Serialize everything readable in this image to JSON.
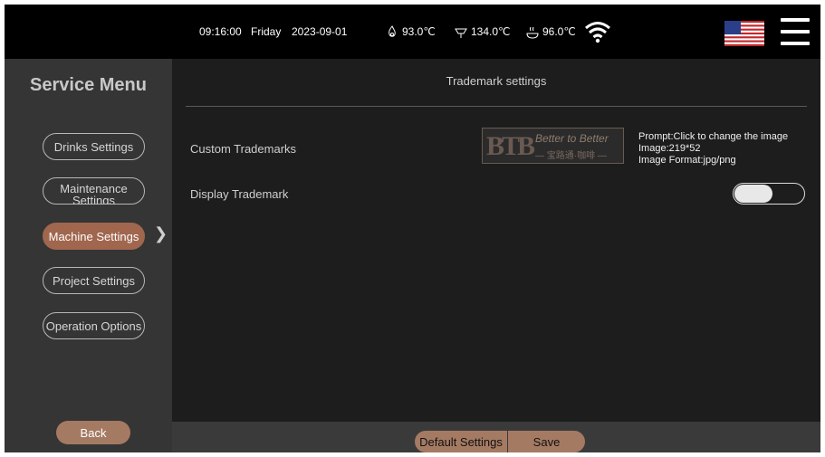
{
  "status_bar": {
    "time": "09:16:00",
    "day": "Friday",
    "date": "2023-09-01",
    "temp1": "93.0℃",
    "temp2": "134.0℃",
    "temp3": "96.0℃"
  },
  "icons": [
    "steam-icon",
    "hot-water-icon",
    "coffee-cup-icon",
    "wifi-icon",
    "us-flag-icon",
    "menu-icon",
    "chevron-right-icon"
  ],
  "sidebar": {
    "title": "Service Menu",
    "items": [
      {
        "label": "Drinks Settings",
        "active": false
      },
      {
        "label": "Maintenance Settings",
        "active": false
      },
      {
        "label": "Machine Settings",
        "active": true
      },
      {
        "label": "Project Settings",
        "active": false
      },
      {
        "label": "Operation Options",
        "active": false
      }
    ],
    "back_label": "Back"
  },
  "main": {
    "title": "Trademark settings",
    "custom_trademarks_label": "Custom Trademarks",
    "display_trademark_label": "Display Trademark",
    "trademark_image": {
      "logo": "BTB",
      "tagline": "Better to Better",
      "subtitle": "— 宝路通·咖啡 —"
    },
    "prompt": {
      "line1": "Prompt:Click to change the image",
      "line2": "Image:219*52",
      "line3": "Image Format:jpg/png"
    },
    "display_trademark_enabled": false
  },
  "bottom_bar": {
    "default_label": "Default Settings",
    "save_label": "Save"
  },
  "colors": {
    "accent": "#a0664e",
    "button": "#a57a63",
    "background": "#1d1d1d",
    "sidebar": "#353535",
    "topbar": "#000000"
  }
}
